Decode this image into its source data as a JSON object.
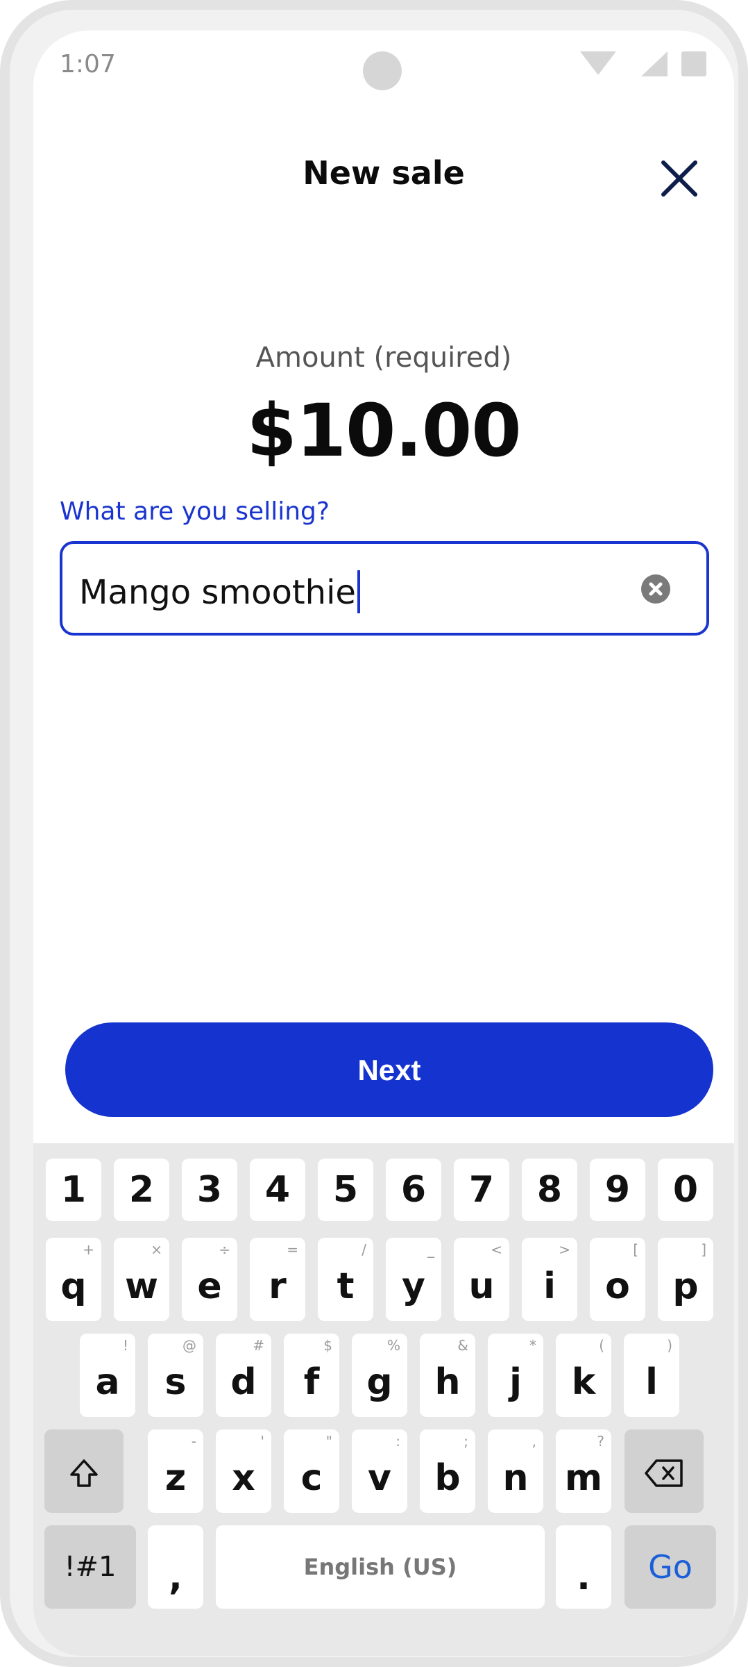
{
  "status_bar": {
    "time": "1:07"
  },
  "header": {
    "title": "New sale",
    "close_icon": "close-icon"
  },
  "amount": {
    "label": "Amount (required)",
    "value": "$10.00"
  },
  "item_field": {
    "label": "What are you selling?",
    "value": "Mango smoothie",
    "clear_icon": "clear-icon"
  },
  "actions": {
    "next_label": "Next"
  },
  "colors": {
    "accent": "#1533ce",
    "label_blue": "#1a35cf",
    "go_blue": "#1a5fd8",
    "keyboard_bg": "#e8e8e8"
  },
  "keyboard": {
    "numbers": [
      "1",
      "2",
      "3",
      "4",
      "5",
      "6",
      "7",
      "8",
      "9",
      "0"
    ],
    "row1": [
      {
        "key": "q",
        "alt": "+"
      },
      {
        "key": "w",
        "alt": "×"
      },
      {
        "key": "e",
        "alt": "÷"
      },
      {
        "key": "r",
        "alt": "="
      },
      {
        "key": "t",
        "alt": "/"
      },
      {
        "key": "y",
        "alt": "_"
      },
      {
        "key": "u",
        "alt": "<"
      },
      {
        "key": "i",
        "alt": ">"
      },
      {
        "key": "o",
        "alt": "["
      },
      {
        "key": "p",
        "alt": "]"
      }
    ],
    "row2": [
      {
        "key": "a",
        "alt": "!"
      },
      {
        "key": "s",
        "alt": "@"
      },
      {
        "key": "d",
        "alt": "#"
      },
      {
        "key": "f",
        "alt": "$"
      },
      {
        "key": "g",
        "alt": "%"
      },
      {
        "key": "h",
        "alt": "&"
      },
      {
        "key": "j",
        "alt": "*"
      },
      {
        "key": "k",
        "alt": "("
      },
      {
        "key": "l",
        "alt": ")"
      }
    ],
    "row3": [
      {
        "key": "z",
        "alt": "-"
      },
      {
        "key": "x",
        "alt": "'"
      },
      {
        "key": "c",
        "alt": "\""
      },
      {
        "key": "v",
        "alt": ":"
      },
      {
        "key": "b",
        "alt": ";"
      },
      {
        "key": "n",
        "alt": ","
      },
      {
        "key": "m",
        "alt": "?"
      }
    ],
    "symbols_label": "!#1",
    "comma_label": ",",
    "space_label": "English (US)",
    "period_label": ".",
    "go_label": "Go",
    "shift_icon": "shift-icon",
    "backspace_icon": "backspace-icon"
  }
}
